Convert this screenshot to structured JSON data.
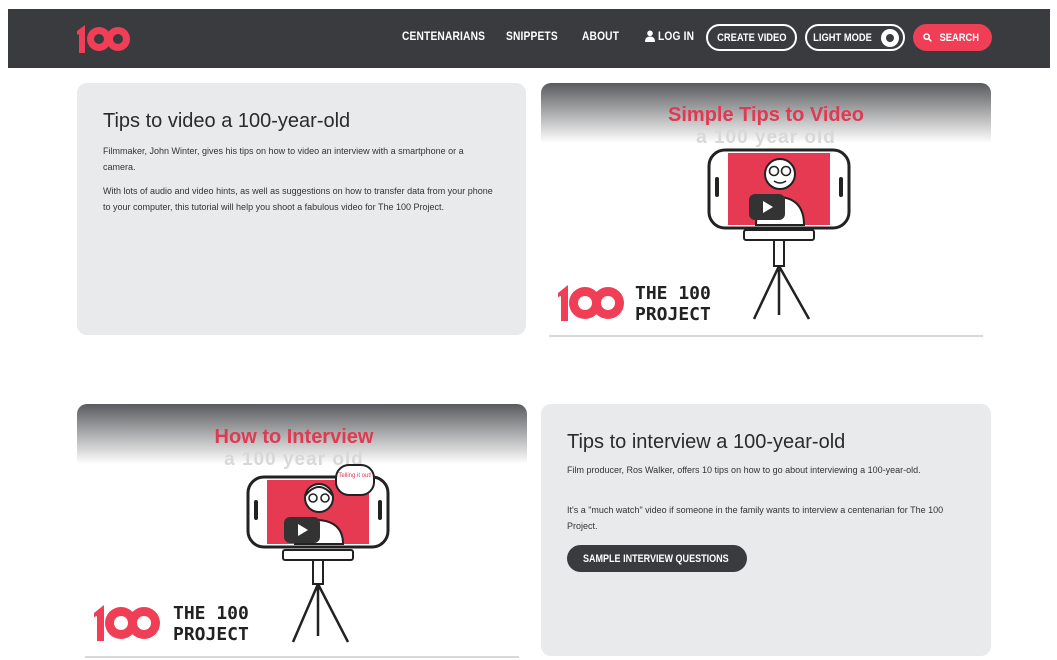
{
  "nav": {
    "links": [
      "CENTENARIANS",
      "SNIPPETS",
      "ABOUT",
      "LOG IN"
    ],
    "create_label": "CREATE VIDEO",
    "lightmode_label": "LIGHT MODE",
    "search_label": "SEARCH"
  },
  "cards": [
    {
      "title": "Tips to video a 100-year-old",
      "paragraphs": [
        "Filmmaker, John Winter, gives his tips on how to video an interview with a smartphone or a camera.",
        "With lots of audio and video hints, as well as suggestions on how to transfer data from your phone to your computer, this tutorial will help you shoot a fabulous video for The 100 Project."
      ]
    },
    {
      "title": "Tips to interview a 100-year-old",
      "paragraphs": [
        "Film producer, Ros Walker, offers 10 tips on how to go about interviewing a 100-year-old.",
        "It's a \"much watch\" video if someone in the family wants to interview a centenarian for The 100 Project."
      ],
      "button_label": "SAMPLE INTERVIEW QUESTIONS"
    }
  ],
  "thumbnails": [
    {
      "title": "Simple Tips to Video",
      "subtitle": "a 100 year old",
      "brand_line1": "THE 100",
      "brand_line2": "PROJECT"
    },
    {
      "title": "How to Interview",
      "subtitle": "a 100 year old",
      "bubble": "Telling it out!",
      "brand_line1": "THE 100",
      "brand_line2": "PROJECT"
    }
  ],
  "colors": {
    "accent": "#ef3e55",
    "nav_bg": "#3a3b3e",
    "card_bg": "#e9eaec"
  },
  "icons": [
    "logo-100",
    "user-icon",
    "toggle-icon",
    "search-icon",
    "play-icon",
    "caret-right-icon"
  ]
}
